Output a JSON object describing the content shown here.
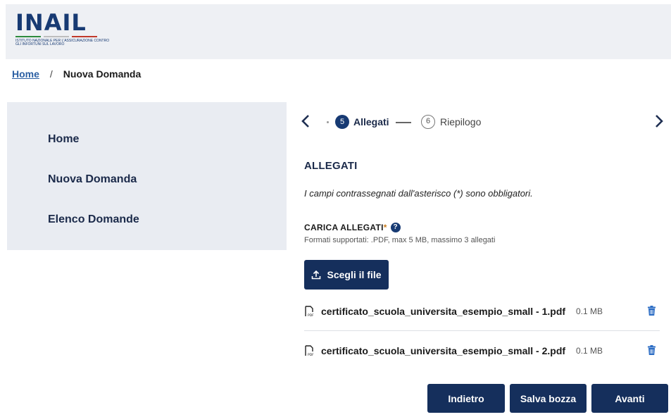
{
  "header": {
    "logo_text": "INAIL",
    "logo_subtitle": "ISTITUTO NAZIONALE PER L'ASSICURAZIONE CONTRO GLI INFORTUNI SUL LAVORO",
    "logo_colors": [
      "#2e8b3e",
      "#bdbdbd",
      "#c0392b"
    ]
  },
  "breadcrumb": {
    "home": "Home",
    "separator": "/",
    "current": "Nuova Domanda"
  },
  "sidebar": {
    "items": [
      {
        "label": "Home"
      },
      {
        "label": "Nuova Domanda"
      },
      {
        "label": "Elenco Domande"
      }
    ]
  },
  "stepper": {
    "prev_icon": "chevron-left-icon",
    "next_icon": "chevron-right-icon",
    "current": {
      "number": "5",
      "label": "Allegati"
    },
    "next": {
      "number": "6",
      "label": "Riepilogo"
    }
  },
  "form": {
    "title": "ALLEGATI",
    "required_note": "I campi contrassegnati dall'asterisco (*) sono obbligatori.",
    "upload_label": "CARICA ALLEGATI",
    "upload_asterisk": "*",
    "help_symbol": "?",
    "upload_hint": "Formati supportati: .PDF, max 5 MB, massimo 3 allegati",
    "choose_button": "Scegli il file",
    "files": [
      {
        "name": "certificato_scuola_universita_esempio_small - 1.pdf",
        "size": "0.1 MB"
      },
      {
        "name": "certificato_scuola_universita_esempio_small - 2.pdf",
        "size": "0.1 MB"
      }
    ]
  },
  "actions": {
    "back": "Indietro",
    "save_draft": "Salva bozza",
    "next": "Avanti"
  },
  "colors": {
    "primary": "#152f5c",
    "sidebar_bg": "#e9ecf2",
    "header_bg": "#eef0f4",
    "trash": "#2b6cc4"
  }
}
